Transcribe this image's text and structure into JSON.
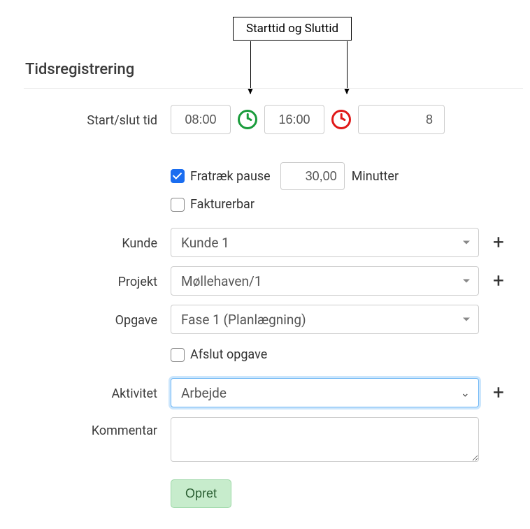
{
  "callout": {
    "text": "Starttid og Sluttid"
  },
  "title": "Tidsregistrering",
  "labels": {
    "start_slut": "Start/slut tid",
    "kunde": "Kunde",
    "projekt": "Projekt",
    "opgave": "Opgave",
    "aktivitet": "Aktivitet",
    "kommentar": "Kommentar"
  },
  "time": {
    "start": "08:00",
    "end": "16:00",
    "hours": "8"
  },
  "pause": {
    "checkbox_label": "Fratræk pause",
    "checked": true,
    "minutes": "30,00",
    "unit": "Minutter"
  },
  "billable": {
    "checkbox_label": "Fakturerbar",
    "checked": false
  },
  "kunde": {
    "value": "Kunde 1"
  },
  "projekt": {
    "value": "Møllehaven/1"
  },
  "opgave": {
    "value": "Fase 1 (Planlægning)"
  },
  "afslut_opgave": {
    "checkbox_label": "Afslut opgave",
    "checked": false
  },
  "aktivitet": {
    "value": "Arbejde"
  },
  "kommentar": {
    "value": ""
  },
  "buttons": {
    "submit": "Opret"
  },
  "icons": {
    "start_clock": "clock-green-icon",
    "end_clock": "clock-red-icon",
    "plus": "+"
  }
}
